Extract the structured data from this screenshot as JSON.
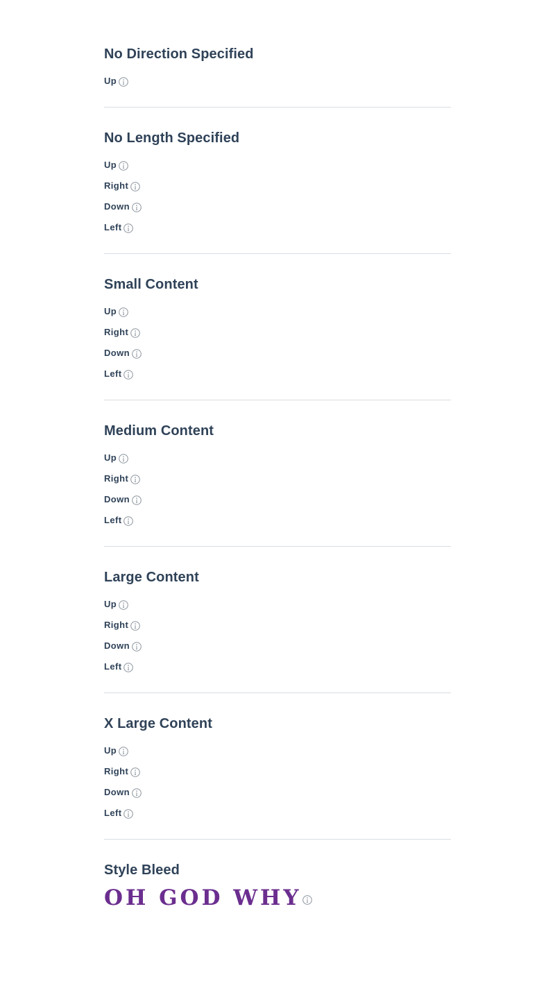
{
  "sections": [
    {
      "title": "No Direction Specified",
      "items": [
        "Up"
      ]
    },
    {
      "title": "No Length Specified",
      "items": [
        "Up",
        "Right",
        "Down",
        "Left"
      ]
    },
    {
      "title": "Small Content",
      "items": [
        "Up",
        "Right",
        "Down",
        "Left"
      ]
    },
    {
      "title": "Medium Content",
      "items": [
        "Up",
        "Right",
        "Down",
        "Left"
      ]
    },
    {
      "title": "Large Content",
      "items": [
        "Up",
        "Right",
        "Down",
        "Left"
      ]
    },
    {
      "title": "X Large Content",
      "items": [
        "Up",
        "Right",
        "Down",
        "Left"
      ]
    }
  ],
  "style_bleed": {
    "title": "Style Bleed",
    "text": "OH GOD WHY"
  },
  "icons": {
    "info": "info-icon"
  },
  "colors": {
    "heading": "#2f4258",
    "divider": "#d9dde2",
    "icon_stroke": "#8a939c",
    "bleed_text": "#6b2e8f"
  }
}
